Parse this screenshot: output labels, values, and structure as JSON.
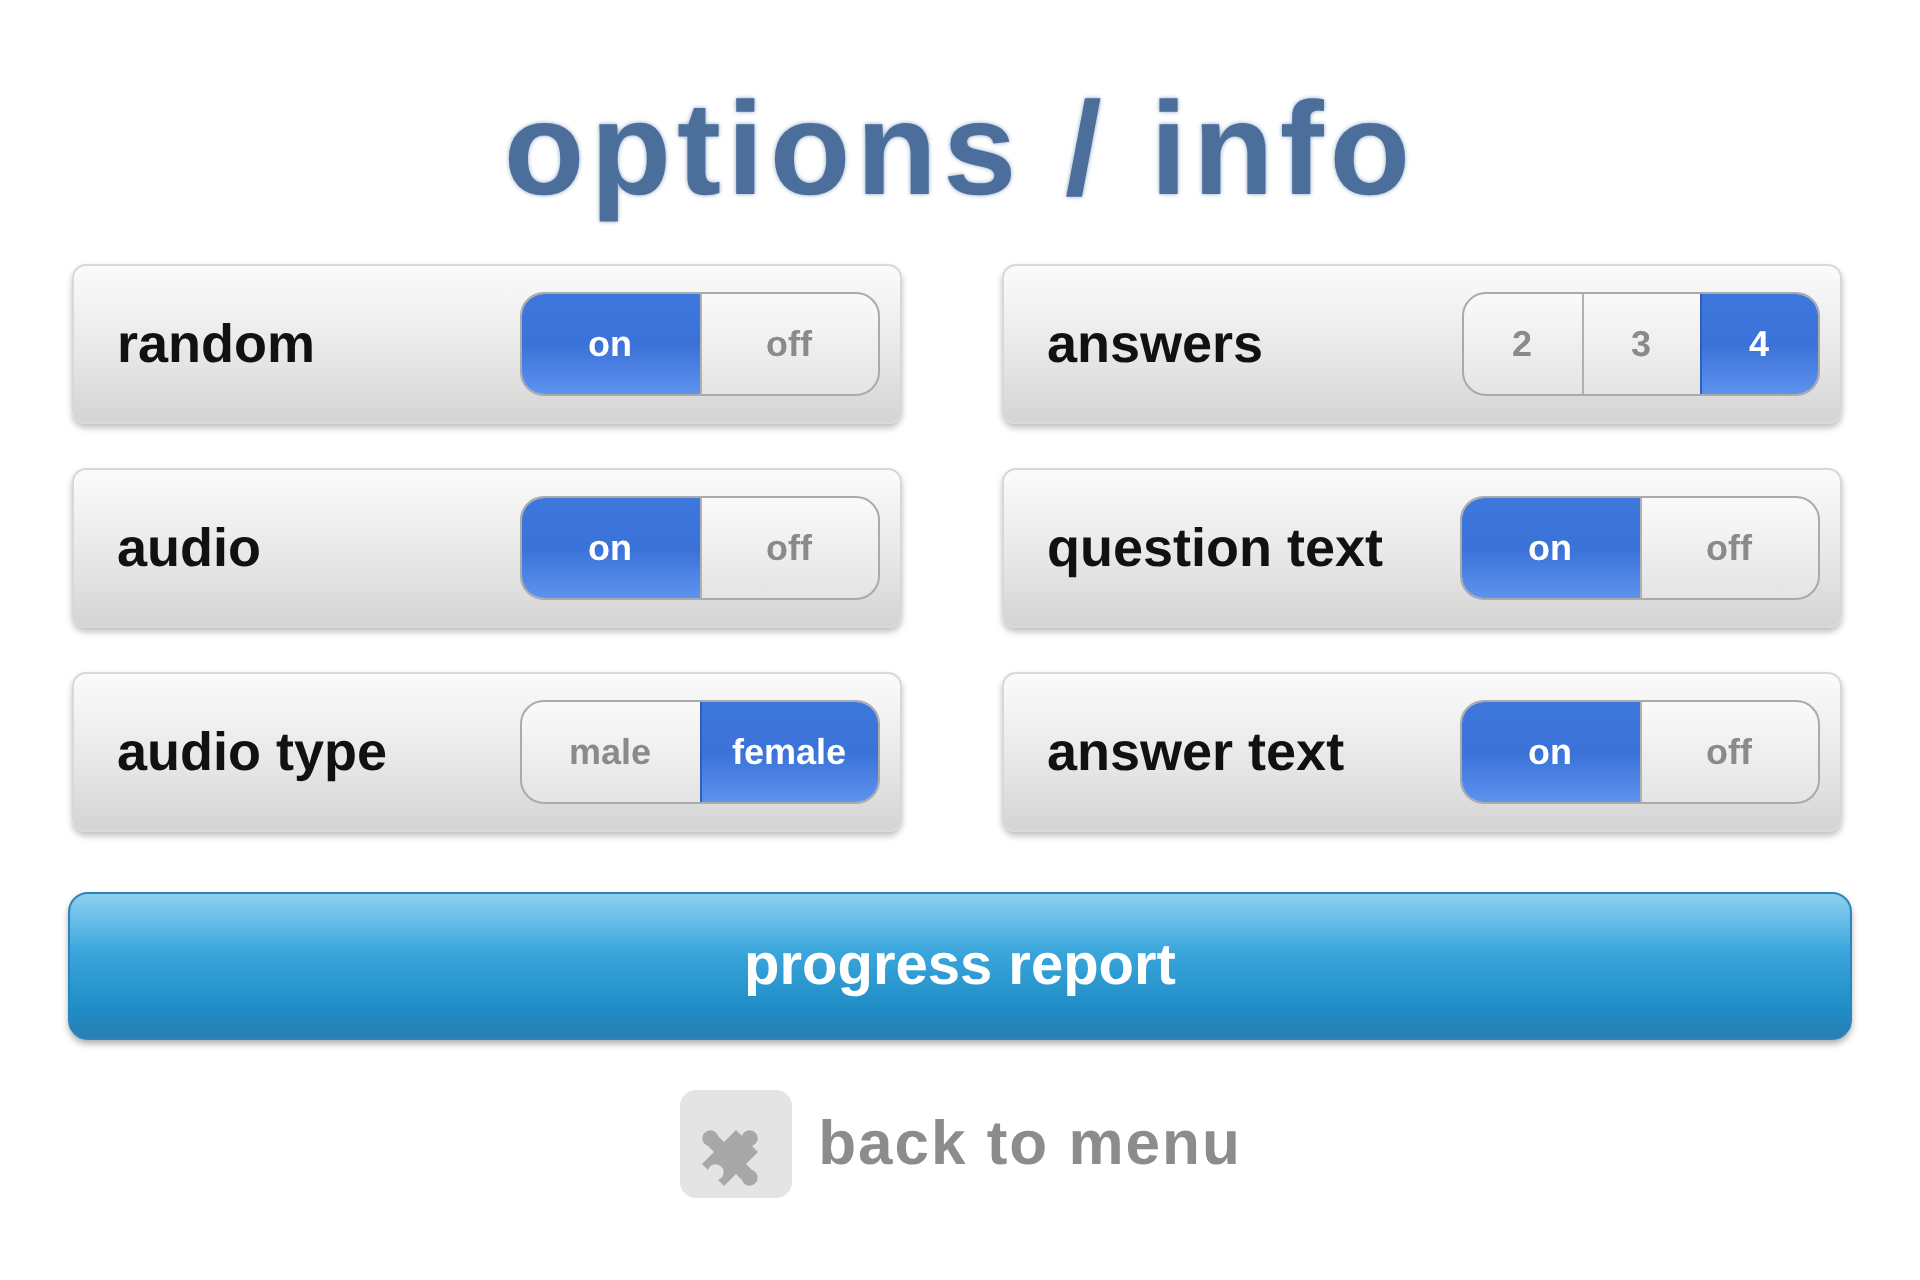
{
  "title": "options / info",
  "settings": [
    {
      "label": "random",
      "options": [
        {
          "label": "on",
          "selected": true
        },
        {
          "label": "off",
          "selected": false
        }
      ]
    },
    {
      "label": "answers",
      "options": [
        {
          "label": "2",
          "selected": false
        },
        {
          "label": "3",
          "selected": false
        },
        {
          "label": "4",
          "selected": true
        }
      ]
    },
    {
      "label": "audio",
      "options": [
        {
          "label": "on",
          "selected": true
        },
        {
          "label": "off",
          "selected": false
        }
      ]
    },
    {
      "label": "question text",
      "options": [
        {
          "label": "on",
          "selected": true
        },
        {
          "label": "off",
          "selected": false
        }
      ]
    },
    {
      "label": "audio type",
      "options": [
        {
          "label": "male",
          "selected": false
        },
        {
          "label": "female",
          "selected": true
        }
      ]
    },
    {
      "label": "answer text",
      "options": [
        {
          "label": "on",
          "selected": true
        },
        {
          "label": "off",
          "selected": false
        }
      ]
    }
  ],
  "progress_button": "progress report",
  "back_button": "back to menu"
}
